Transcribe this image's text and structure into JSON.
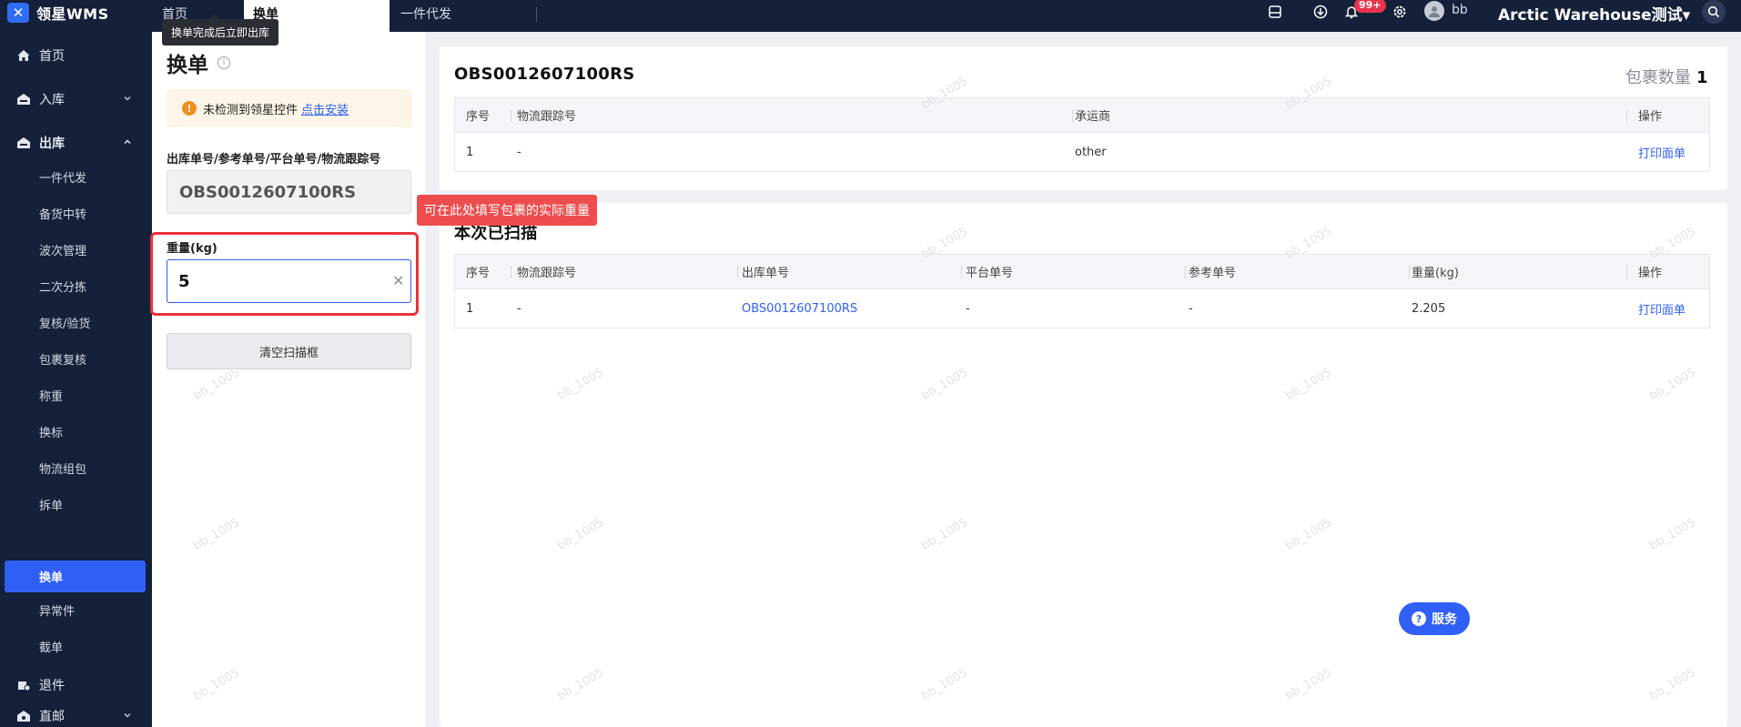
{
  "app": {
    "logo_text": "领星WMS"
  },
  "topbar": {
    "tabs": [
      {
        "label": "首页"
      },
      {
        "label": "换单"
      },
      {
        "label": "一件代发"
      }
    ],
    "tooltip": "换单完成后立即出库",
    "notification_badge": "99+",
    "user_name": "bb",
    "warehouse_name": "Arctic Warehouse测试▾"
  },
  "sidebar": {
    "home": "首页",
    "inbound": "入库",
    "outbound": "出库",
    "outbound_items": [
      "一件代发",
      "备货中转",
      "波次管理",
      "二次分拣",
      "复核/验货",
      "包裹复核",
      "称重",
      "换标",
      "物流组包",
      "拆单",
      "换单",
      "异常件",
      "截单"
    ],
    "returns": "退件",
    "direct_mail": "直邮"
  },
  "left_panel": {
    "title": "换单",
    "alert_text": "未检测到领星控件",
    "alert_link": "点击安装",
    "order_label": "出库单号/参考单号/平台单号/物流跟踪号",
    "order_value": "OBS0012607100RS",
    "weight_label": "重量(kg)",
    "weight_value": "5",
    "clear_button": "清空扫描框",
    "callout": "可在此处填写包裹的实际重量"
  },
  "package_card": {
    "title": "OBS0012607100RS",
    "count_label": "包裹数量",
    "count_value": "1",
    "headers": [
      "序号",
      "物流跟踪号",
      "承运商",
      "操作"
    ],
    "rows": [
      {
        "index": "1",
        "tracking": "-",
        "carrier": "other",
        "action": "打印面单"
      }
    ]
  },
  "scan_card": {
    "title": "本次已扫描",
    "headers": [
      "序号",
      "物流跟踪号",
      "出库单号",
      "平台单号",
      "参考单号",
      "重量(kg)",
      "操作"
    ],
    "rows": [
      {
        "index": "1",
        "tracking": "-",
        "order_no": "OBS0012607100RS",
        "platform_no": "-",
        "ref_no": "-",
        "weight": "2.205",
        "action": "打印面单"
      }
    ]
  },
  "watermark_text": "bb_1005",
  "service_button": "服务"
}
